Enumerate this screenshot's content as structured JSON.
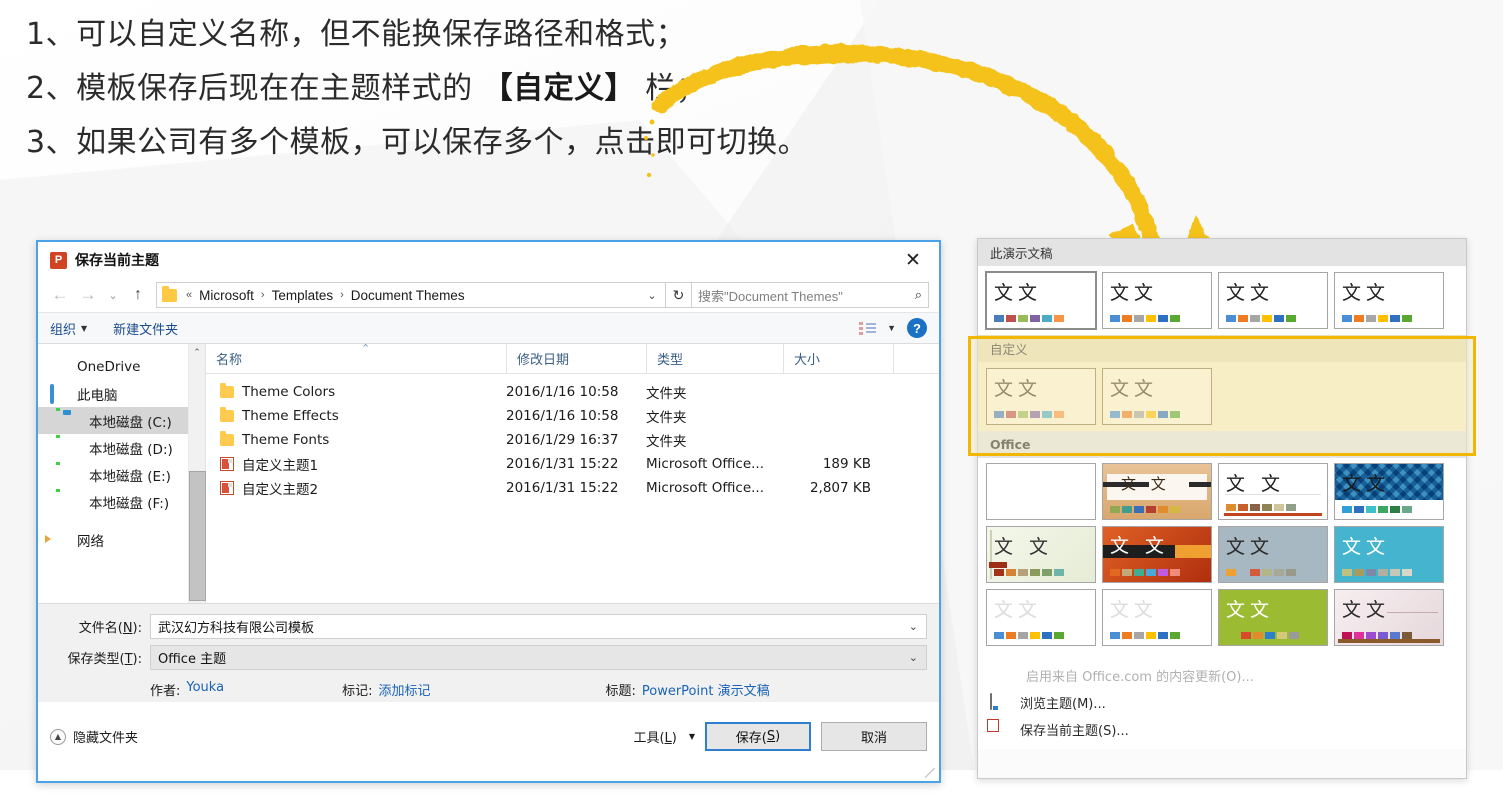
{
  "slide": {
    "headline_lines": [
      {
        "pre": "1、可以自定义名称，但不能换保存路径和格式；",
        "bold": "",
        "post": ""
      },
      {
        "pre": "2、模板保存后现在在主题样式的 ",
        "bold": "【自定义】",
        "post": " 栏；"
      },
      {
        "pre": "3、如果公司有多个模板，可以保存多个，点击即可切换。",
        "bold": "",
        "post": ""
      }
    ],
    "arrow_color": "#f5c21b"
  },
  "dialog": {
    "title": "保存当前主题",
    "title_icon": "powerpoint-icon",
    "close_label": "✕",
    "nav": {
      "back_icon": "←",
      "forward_icon": "→",
      "recent_icon": "⌄",
      "up_icon": "↑",
      "breadcrumbs": [
        "«",
        "Microsoft",
        "›",
        "Templates",
        "›",
        "Document Themes"
      ],
      "dropdown_caret": "⌄",
      "refresh_icon": "↻",
      "search_placeholder": "搜索\"Document Themes\"",
      "search_icon": "⌕"
    },
    "toolbar": {
      "organize": "组织",
      "new_folder": "新建文件夹",
      "caret": "▼",
      "help": "?"
    },
    "nav_pane": {
      "items": [
        {
          "label": "OneDrive",
          "icon": "onedrive-icon",
          "indent": false,
          "selected": false
        },
        {
          "label": "此电脑",
          "icon": "this-pc-icon",
          "indent": false,
          "selected": false
        },
        {
          "label": "本地磁盘 (C:)",
          "icon": "system-drive-icon",
          "indent": true,
          "selected": true
        },
        {
          "label": "本地磁盘 (D:)",
          "icon": "drive-icon",
          "indent": true,
          "selected": false
        },
        {
          "label": "本地磁盘 (E:)",
          "icon": "drive-icon",
          "indent": true,
          "selected": false
        },
        {
          "label": "本地磁盘 (F:)",
          "icon": "drive-icon",
          "indent": true,
          "selected": false
        },
        {
          "label": "网络",
          "icon": "network-icon",
          "indent": false,
          "selected": false
        }
      ],
      "scroll_up": "⌃",
      "scroll_down": "⌄"
    },
    "file_list": {
      "columns": [
        "名称",
        "修改日期",
        "类型",
        "大小"
      ],
      "sort_caret": "⌃",
      "rows": [
        {
          "icon": "folder-icon",
          "name": "Theme Colors",
          "date": "2016/1/16 10:58",
          "type": "文件夹",
          "size": ""
        },
        {
          "icon": "folder-icon",
          "name": "Theme Effects",
          "date": "2016/1/16 10:58",
          "type": "文件夹",
          "size": ""
        },
        {
          "icon": "folder-icon",
          "name": "Theme Fonts",
          "date": "2016/1/29 16:37",
          "type": "文件夹",
          "size": ""
        },
        {
          "icon": "theme-file-icon",
          "name": "自定义主题1",
          "date": "2016/1/31 15:22",
          "type": "Microsoft Office...",
          "size": "189 KB"
        },
        {
          "icon": "theme-file-icon",
          "name": "自定义主题2",
          "date": "2016/1/31 15:22",
          "type": "Microsoft Office...",
          "size": "2,807 KB"
        }
      ]
    },
    "form": {
      "filename_label_pre": "文件名(",
      "filename_label_key": "N",
      "filename_label_post": "):",
      "filename_value": "武汉幻方科技有限公司模板",
      "savetype_label_pre": "保存类型(",
      "savetype_label_key": "T",
      "savetype_label_post": "):",
      "savetype_value": "Office 主题",
      "caret": "⌄",
      "author_key": "作者:",
      "author_value": "Youka",
      "tags_key": "标记:",
      "tags_value": "添加标记",
      "title_key": "标题:",
      "title_value": "PowerPoint 演示文稿"
    },
    "actions": {
      "hide_folders": "隐藏文件夹",
      "hide_folders_icon": "▲",
      "tools_pre": "工具(",
      "tools_key": "L",
      "tools_post": ")",
      "tools_caret": "▼",
      "save_pre": "保存(",
      "save_key": "S",
      "save_post": ")",
      "cancel": "取消"
    }
  },
  "gallery": {
    "groups": [
      {
        "name": "此演示文稿",
        "highlighted": false,
        "thumbs": [
          {
            "text": "文文",
            "selected": true,
            "swatches": [
              "#4a7ebb",
              "#c0504d",
              "#9bbb59",
              "#8064a2",
              "#4bacc6",
              "#f79646"
            ]
          },
          {
            "text": "文文",
            "selected": false,
            "swatches": [
              "#4a8ed6",
              "#ee7c22",
              "#a6a6a6",
              "#ffc000",
              "#2f71c0",
              "#5aa832"
            ]
          },
          {
            "text": "文文",
            "selected": false,
            "swatches": [
              "#4a8ed6",
              "#ee7c22",
              "#a6a6a6",
              "#ffc000",
              "#2f71c0",
              "#5aa832"
            ]
          },
          {
            "text": "文文",
            "selected": false,
            "swatches": [
              "#4a8ed6",
              "#ee7c22",
              "#a6a6a6",
              "#ffc000",
              "#2f71c0",
              "#5aa832"
            ]
          }
        ]
      },
      {
        "name": "自定义",
        "highlighted": true,
        "thumbs": [
          {
            "text": "文文",
            "selected": false,
            "swatches": [
              "#4a7ebb",
              "#c0504d",
              "#9bbb59",
              "#8064a2",
              "#4bacc6",
              "#f79646"
            ]
          },
          {
            "text": "文文",
            "selected": false,
            "swatches": [
              "#4a8ed6",
              "#ee7c22",
              "#a6a6a6",
              "#ffc000",
              "#2f71c0",
              "#5aa832"
            ]
          }
        ]
      },
      {
        "name": "Office",
        "highlighted": false,
        "thumbs": [
          {
            "text": "",
            "selected": false,
            "bg": "#ffffff",
            "fg": "#222222",
            "swatches": []
          },
          {
            "text": "文 文",
            "selected": false,
            "bg": "#e3b585",
            "fg": "#3a2b18",
            "band": "#2b2b2b",
            "swatches": [
              "#93a755",
              "#3f9e8d",
              "#3a6fb5",
              "#b5402f",
              "#e08b2e",
              "#d4b840"
            ]
          },
          {
            "text": "文 文",
            "selected": false,
            "bg": "#ffffff",
            "fg": "#222222",
            "band": "#c0451f",
            "swatches": [
              "#e08b2e",
              "#c95f2b",
              "#8a6248",
              "#8f8453",
              "#cfc79a",
              "#93a087"
            ]
          },
          {
            "text": "文文",
            "selected": false,
            "bg": "#2e7fae",
            "fg": "#1a1a1a",
            "pattern": true,
            "swatches": [
              "#2f9fd6",
              "#2f6fc0",
              "#3ec0c8",
              "#3aa860",
              "#2e7d45",
              "#6aa88a"
            ]
          },
          {
            "text": "文 文",
            "selected": false,
            "bg": "#eef2e2",
            "fg": "#333333",
            "band": "#9e2f16",
            "swatches": [
              "#a33318",
              "#d58234",
              "#b5a079",
              "#8a9a5a",
              "#7fa06a",
              "#6cb5a8"
            ]
          },
          {
            "text": "文 文",
            "selected": false,
            "bg": "#d3471a",
            "fg": "#ffffff",
            "band": "#1e1e1e",
            "swatches": [
              "#e06820",
              "#c4a878",
              "#3fae8e",
              "#4aa8d8",
              "#c05ae0",
              "#f08a7a"
            ]
          },
          {
            "text": "文文",
            "selected": false,
            "bg": "#a8b8c2",
            "fg": "#2a2a2a",
            "swatches": [
              "#f0a030",
              "#ffffff",
              "#d35a3a",
              "#b5b58a",
              "#a8a896",
              "#9a9a8a"
            ]
          },
          {
            "text": "文文",
            "selected": false,
            "bg": "#45b5cf",
            "fg": "#ffffff",
            "swatches": [
              "#c0c080",
              "#a89a60",
              "#7a8aa8",
              "#b0b0a0",
              "#c8c8b8",
              "#d8d8c8"
            ]
          },
          {
            "text": "文文",
            "selected": false,
            "bg": "#ffffff",
            "fg": "#d8d8d8",
            "swatches": [
              "#4a8ed6",
              "#ee7c22",
              "#a6a6a6",
              "#ffc000",
              "#2f71c0",
              "#5aa832"
            ]
          },
          {
            "text": "文文",
            "selected": false,
            "bg": "#ffffff",
            "fg": "#d8d8d8",
            "swatches": [
              "#4a8ed6",
              "#ee7c22",
              "#a6a6a6",
              "#ffc000",
              "#2f71c0",
              "#5aa832"
            ]
          },
          {
            "text": "文文",
            "selected": false,
            "bg": "#9bbb33",
            "fg": "#ffffff",
            "swatches": [
              "#d84a2a",
              "#e08b2e",
              "#2f7fd1",
              "#d4c87a",
              "#9a9a9a"
            ]
          },
          {
            "text": "文文",
            "selected": false,
            "bg": "#f0e4e4",
            "fg": "#2a2a2a",
            "band": "#8a5a2a",
            "swatches": [
              "#c0105a",
              "#e0309a",
              "#a04ad0",
              "#7a5ad0",
              "#5a7ad0",
              "#7a5a3a"
            ]
          }
        ]
      }
    ],
    "footer": [
      {
        "label": "启用来自 Office.com 的内容更新(O)...",
        "icon": "",
        "disabled": true
      },
      {
        "label": "浏览主题(M)...",
        "icon": "browse-theme-icon",
        "disabled": false
      },
      {
        "label": "保存当前主题(S)...",
        "icon": "save-theme-icon",
        "disabled": false
      }
    ]
  }
}
